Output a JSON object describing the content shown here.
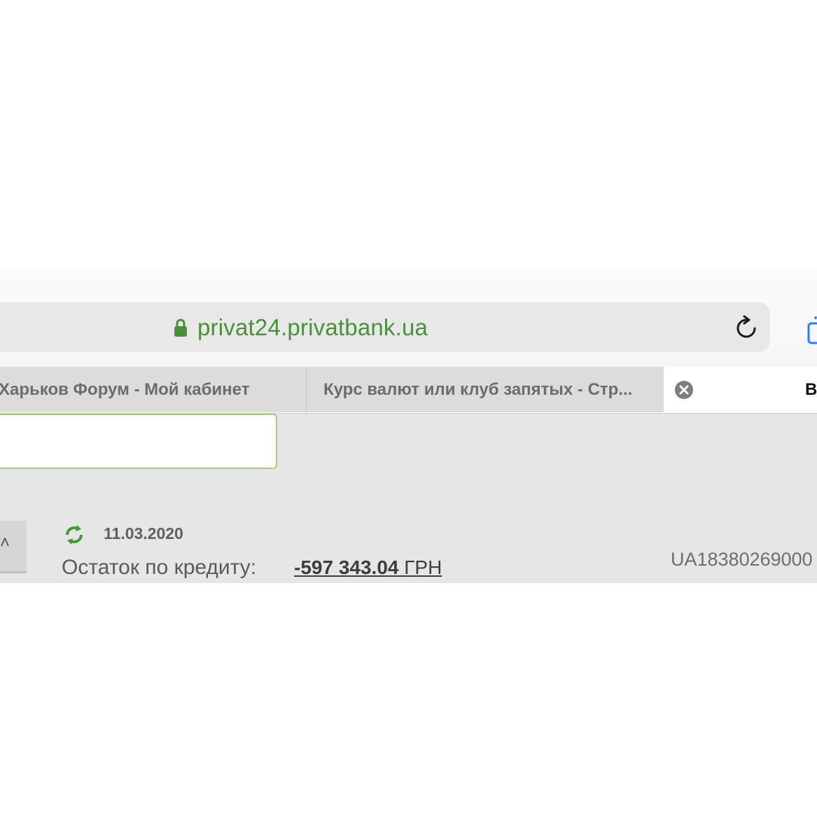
{
  "browser": {
    "url": "privat24.privatbank.ua",
    "accent_color": "#4a8f3c",
    "tabs": [
      {
        "label": "Харьков Форум - Мой кабинет"
      },
      {
        "label": "Курс валют или клуб запятых - Стр..."
      },
      {
        "label": "В"
      }
    ],
    "icons": {
      "lock": "lock-icon",
      "reload": "reload-icon",
      "close_tab": "close-icon",
      "share": "share-icon"
    }
  },
  "account": {
    "date": "11.03.2020",
    "balance_label": "Остаток по кредиту:",
    "balance_amount": "-597 343.04",
    "currency": "ГРН",
    "iban": "UA18380269000",
    "status_color": "#3f9b35"
  }
}
